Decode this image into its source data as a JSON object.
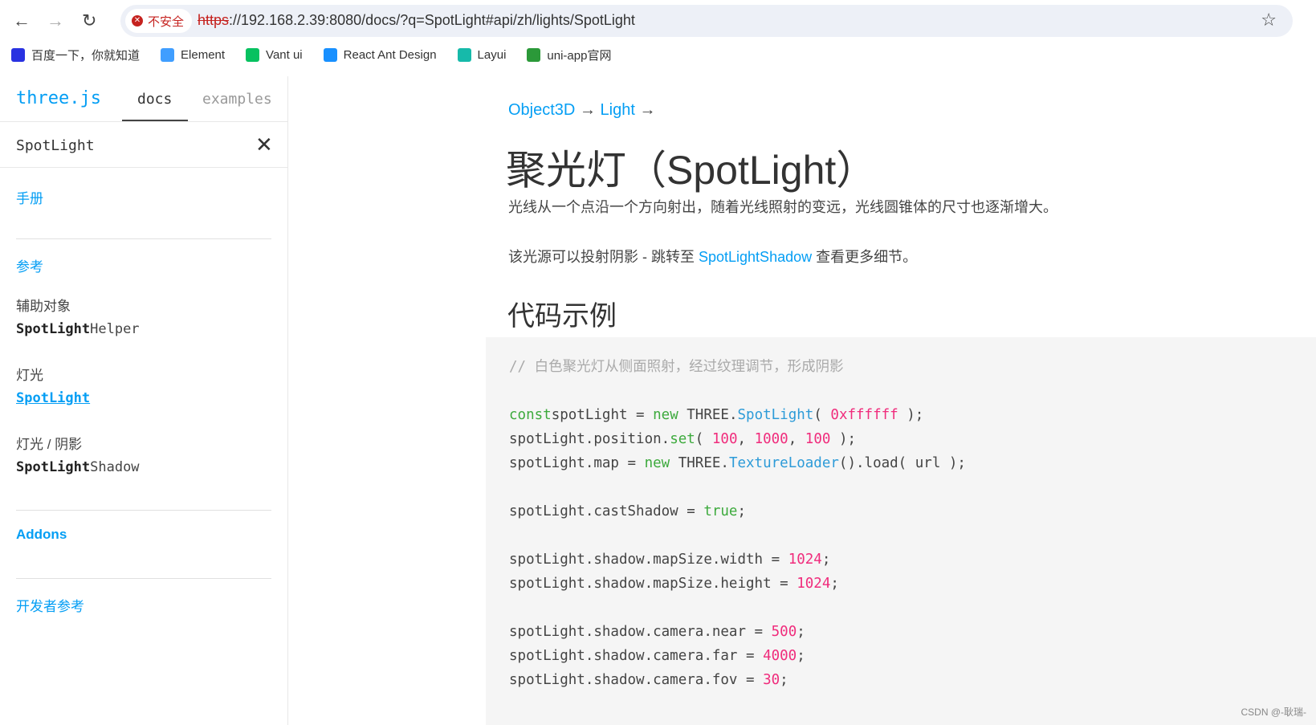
{
  "browser": {
    "url_scheme": "https",
    "url_rest": "://192.168.2.39:8080/docs/?q=SpotLight#api/zh/lights/SpotLight",
    "security_label": "不安全",
    "bookmarks": [
      {
        "label": "百度一下，你就知道",
        "color": "#2932e1"
      },
      {
        "label": "Element",
        "color": "#409eff"
      },
      {
        "label": "Vant ui",
        "color": "#07c160"
      },
      {
        "label": "React Ant Design",
        "color": "#1890ff"
      },
      {
        "label": "Layui",
        "color": "#16baaa"
      },
      {
        "label": "uni-app官网",
        "color": "#2b9939"
      }
    ]
  },
  "sidebar": {
    "logo": "three.js",
    "tabs": [
      "docs",
      "examples"
    ],
    "search_value": "SpotLight",
    "sections": {
      "manual": "手册",
      "reference": "参考",
      "addons": "Addons",
      "dev": "开发者参考"
    },
    "groups": [
      {
        "category": "辅助对象",
        "match": "SpotLight",
        "rest": "Helper"
      },
      {
        "category": "灯光",
        "match": "SpotLight",
        "rest": ""
      },
      {
        "category": "灯光 / 阴影",
        "match": "SpotLight",
        "rest": "Shadow"
      }
    ]
  },
  "content": {
    "breadcrumb": [
      "Object3D",
      "Light"
    ],
    "arrow": "→",
    "title": "聚光灯（SpotLight）",
    "desc": "光线从一个点沿一个方向射出，随着光线照射的变远，光线圆锥体的尺寸也逐渐增大。",
    "shadow_pre": "该光源可以投射阴影 - 跳转至 ",
    "shadow_link": "SpotLightShadow",
    "shadow_post": " 查看更多细节。",
    "code_heading": "代码示例",
    "code": [
      [
        [
          "c",
          "// 白色聚光灯从侧面照射，经过纹理调节，形成阴影"
        ]
      ],
      [],
      [
        [
          "k",
          "const"
        ],
        [
          "",
          "spotLight = "
        ],
        [
          "k",
          "new"
        ],
        [
          "",
          " THREE."
        ],
        [
          "f",
          "SpotLight"
        ],
        [
          "",
          "( "
        ],
        [
          "n",
          "0xffffff"
        ],
        [
          "",
          " );"
        ]
      ],
      [
        [
          "",
          "spotLight.position."
        ],
        [
          "k",
          "set"
        ],
        [
          "",
          "( "
        ],
        [
          "n",
          "100"
        ],
        [
          "",
          ", "
        ],
        [
          "n",
          "1000"
        ],
        [
          "",
          ", "
        ],
        [
          "n",
          "100"
        ],
        [
          "",
          " );"
        ]
      ],
      [
        [
          "",
          "spotLight.map = "
        ],
        [
          "k",
          "new"
        ],
        [
          "",
          " THREE."
        ],
        [
          "f",
          "TextureLoader"
        ],
        [
          "",
          "().load( url );"
        ]
      ],
      [],
      [
        [
          "",
          "spotLight.castShadow = "
        ],
        [
          "k",
          "true"
        ],
        [
          "",
          ";"
        ]
      ],
      [],
      [
        [
          "",
          "spotLight.shadow.mapSize.width = "
        ],
        [
          "n",
          "1024"
        ],
        [
          "",
          ";"
        ]
      ],
      [
        [
          "",
          "spotLight.shadow.mapSize.height = "
        ],
        [
          "n",
          "1024"
        ],
        [
          "",
          ";"
        ]
      ],
      [],
      [
        [
          "",
          "spotLight.shadow.camera.near = "
        ],
        [
          "n",
          "500"
        ],
        [
          "",
          ";"
        ]
      ],
      [
        [
          "",
          "spotLight.shadow.camera.far = "
        ],
        [
          "n",
          "4000"
        ],
        [
          "",
          ";"
        ]
      ],
      [
        [
          "",
          "spotLight.shadow.camera.fov = "
        ],
        [
          "n",
          "30"
        ],
        [
          "",
          ";"
        ]
      ]
    ]
  },
  "watermark": "CSDN @-耿瑞-"
}
